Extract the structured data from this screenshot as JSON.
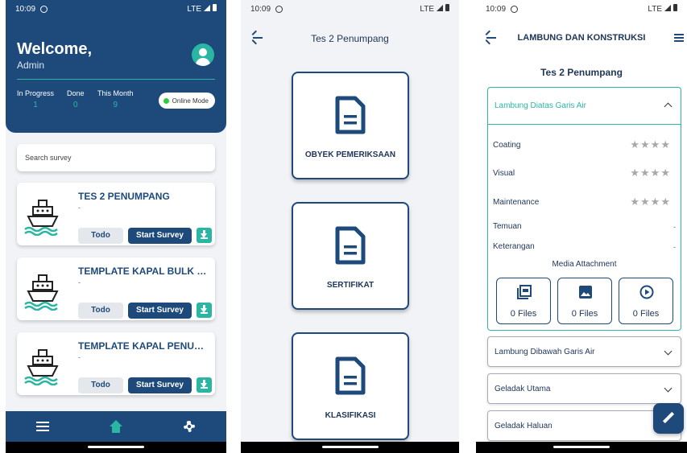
{
  "status": {
    "time": "10:09",
    "network": "LTE"
  },
  "dashboard": {
    "welcome": "Welcome,",
    "user": "Admin",
    "stats": [
      {
        "label": "In Progress",
        "value": "1"
      },
      {
        "label": "Done",
        "value": "0"
      },
      {
        "label": "This Month",
        "value": "9"
      }
    ],
    "mode": "Online Mode",
    "search_placeholder": "Search survey",
    "todo_label": "Todo",
    "start_label": "Start Survey",
    "surveys": [
      {
        "title": "TES 2 PENUMPANG",
        "subtitle": "-"
      },
      {
        "title": "TEMPLATE KAPAL BULK  C...",
        "subtitle": "-"
      },
      {
        "title": "TEMPLATE KAPAL PENUMP...",
        "subtitle": "-"
      }
    ],
    "nav_icons": [
      "list-icon",
      "home-icon",
      "gear-icon"
    ]
  },
  "categories": {
    "title": "Tes 2 Penumpang",
    "items": [
      "OBYEK PEMERIKSAAN",
      "SERTIFIKAT",
      "KLASIFIKASI"
    ]
  },
  "inspection": {
    "title": "LAMBUNG DAN KONSTRUKSI",
    "subtitle": "Tes 2 Penumpang",
    "open_section": "Lambung Diatas Garis Air",
    "ratings": [
      {
        "label": "Coating",
        "stars": 0
      },
      {
        "label": "Visual",
        "stars": 0
      },
      {
        "label": "Maintenance",
        "stars": 0
      }
    ],
    "notes": [
      {
        "label": "Temuan",
        "value": "-"
      },
      {
        "label": "Keterangan",
        "value": "-"
      }
    ],
    "media_title": "Media Attachment",
    "media": [
      {
        "icon": "pdf-icon",
        "label": "0 Files"
      },
      {
        "icon": "image-icon",
        "label": "0 Files"
      },
      {
        "icon": "play-icon",
        "label": "0 Files"
      }
    ],
    "sections": [
      "Lambung Dibawah Garis Air",
      "Geladak Utama",
      "Geladak Haluan"
    ],
    "star_glyphs": "★★★★"
  },
  "colors": {
    "primary": "#1d4a7a",
    "accent": "#2bb6a4",
    "online": "#2ecc40"
  }
}
